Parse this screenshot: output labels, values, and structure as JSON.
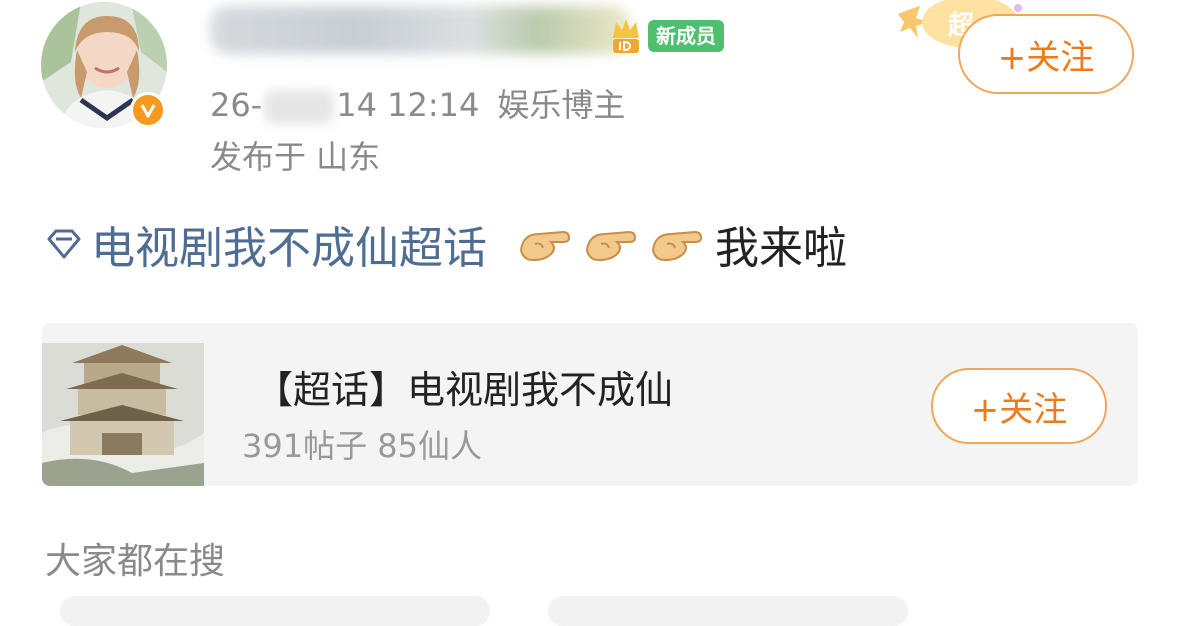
{
  "user": {
    "badge_new": "新成员",
    "meta_date_start": "26-",
    "meta_date_end": "14 12:14",
    "role": "娱乐博主",
    "location": "发布于 山东",
    "follow_label": "+关注",
    "deco_text": "超"
  },
  "post": {
    "topic": "电视剧我不成仙超话",
    "tail": "我来啦"
  },
  "card": {
    "title": "【超话】电视剧我不成仙",
    "stats": "391帖子 85仙人",
    "follow_label": "+关注"
  },
  "section": {
    "title": "大家都在搜"
  },
  "colors": {
    "accent": "#f07a16",
    "link": "#4f6d92",
    "badge_green": "#4fbf6f",
    "verified": "#f49a1f"
  }
}
